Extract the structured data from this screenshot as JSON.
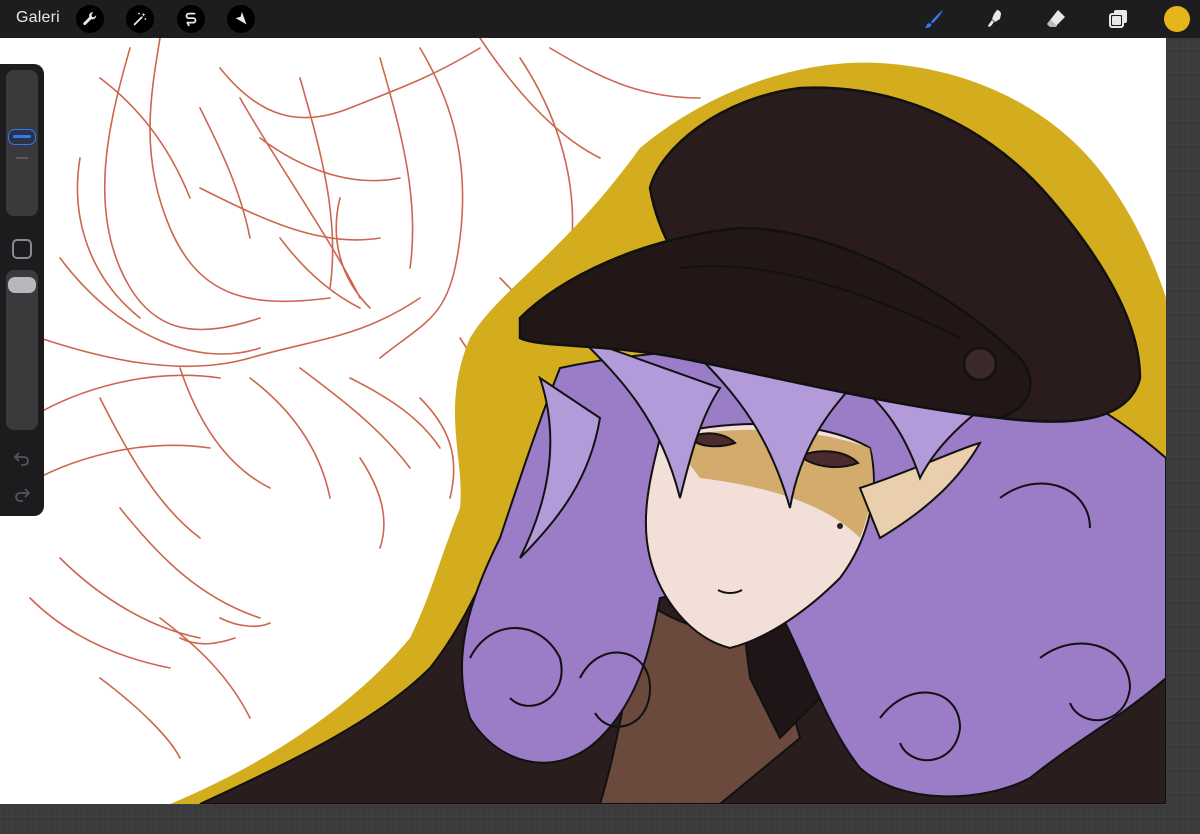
{
  "topbar": {
    "gallery_label": "Galeri",
    "left_tools": [
      {
        "name": "actions",
        "icon": "wrench-icon"
      },
      {
        "name": "adjustments",
        "icon": "magic-wand-icon"
      },
      {
        "name": "selection",
        "icon": "selection-s-icon"
      },
      {
        "name": "transform",
        "icon": "arrow-cursor-icon"
      }
    ],
    "right_tools": [
      {
        "name": "brush",
        "icon": "brush-icon",
        "active": true
      },
      {
        "name": "smudge",
        "icon": "smudge-icon",
        "active": false
      },
      {
        "name": "eraser",
        "icon": "eraser-icon",
        "active": false
      },
      {
        "name": "layers",
        "icon": "layers-icon",
        "active": false
      }
    ],
    "current_color": "#e6b51c"
  },
  "sidebar": {
    "brush_size_level": 0.55,
    "opacity_level": 0.95,
    "icons": [
      "square-modify-icon",
      "undo-icon",
      "redo-icon"
    ]
  },
  "colors": {
    "accent_blue": "#3478f6",
    "sketch_red": "#c8553d",
    "outline_yellow": "#d4ad1f",
    "hat_brown": "#2a1c1c",
    "hair_purple": "#9a7cc7",
    "skin": "#f1dfd8"
  }
}
